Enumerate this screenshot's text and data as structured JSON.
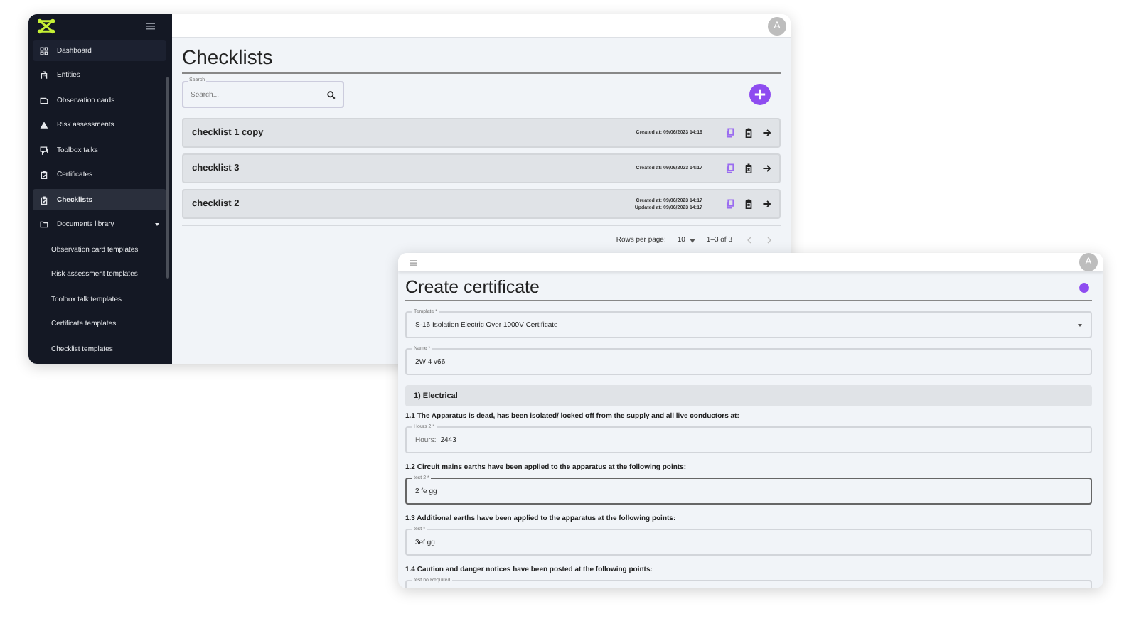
{
  "checklists_window": {
    "sidebar": {
      "items": [
        {
          "label": "Dashboard",
          "selected": false
        },
        {
          "label": "Entities",
          "selected": false
        },
        {
          "label": "Observation cards",
          "selected": false
        },
        {
          "label": "Risk assessments",
          "selected": false
        },
        {
          "label": "Toolbox talks",
          "selected": false
        },
        {
          "label": "Certificates",
          "selected": false
        },
        {
          "label": "Checklists",
          "selected": true
        },
        {
          "label": "Documents library",
          "selected": false,
          "expanded": true,
          "children": [
            {
              "label": "Observation card templates",
              "selected": false
            },
            {
              "label": "Risk assessment templates",
              "selected": false
            },
            {
              "label": "Toolbox talk templates",
              "selected": false
            },
            {
              "label": "Certificate templates",
              "selected": false
            },
            {
              "label": "Checklist templates",
              "selected": false
            }
          ]
        }
      ]
    },
    "avatar": "A",
    "title": "Checklists",
    "search": {
      "label": "Search",
      "placeholder": "Search..."
    },
    "rows": [
      {
        "name": "checklist 1 copy",
        "dates": [
          "Created at: 09/06/2023 14:19"
        ]
      },
      {
        "name": "checklist 3",
        "dates": [
          "Created at: 09/06/2023 14:17"
        ]
      },
      {
        "name": "checklist 2",
        "dates": [
          "Created at: 09/06/2023 14:17",
          "Updated at: 09/06/2023 14:17"
        ]
      }
    ],
    "pagination": {
      "rows_per_page_label": "Rows per page:",
      "rows_per_page": "10",
      "range": "1–3 of 3"
    }
  },
  "certificate_window": {
    "avatar": "A",
    "title": "Create certificate",
    "template_field": {
      "label": "Template *",
      "value": "S-16 Isolation Electric Over 1000V Certificate"
    },
    "name_field": {
      "label": "Name *",
      "value": "2W 4 v66"
    },
    "section": "1) Electrical",
    "questions": [
      {
        "text": "1.1 The Apparatus is dead, has been isolated/ locked off from the supply and all live conductors at:",
        "field": {
          "label": "Hours 2 *",
          "prefix": "Hours:",
          "value": "2443",
          "focused": false
        }
      },
      {
        "text": "1.2 Circuit mains earths have been applied to the apparatus at the following points:",
        "field": {
          "label": "test 2 *",
          "value": "2 fe gg",
          "focused": true
        }
      },
      {
        "text": "1.3 Additional earths have been applied to the apparatus at the following points:",
        "field": {
          "label": "test *",
          "value": "3ef gg",
          "focused": false
        }
      },
      {
        "text": "1.4 Caution and danger notices have been posted at the following points:",
        "field": {
          "label": "test no Required",
          "focused": false
        }
      }
    ]
  }
}
